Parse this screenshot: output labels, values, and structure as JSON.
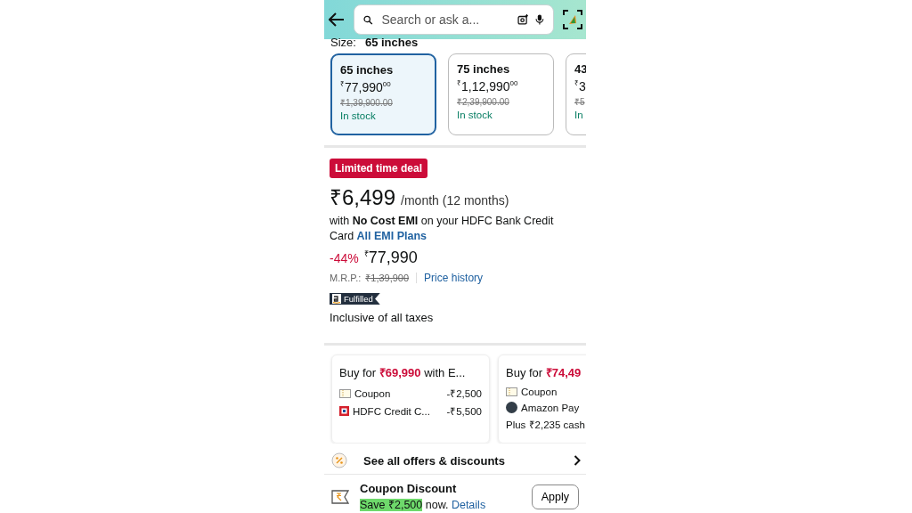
{
  "header": {
    "search": {
      "placeholder": "Search or ask a..."
    }
  },
  "size": {
    "label": "Size:",
    "value": "65 inches"
  },
  "size_options": [
    {
      "name": "65 inches",
      "price": "$^{₹}$77,990$^{00}$",
      "mrp": "₹1,39,900.00",
      "stock": "In stock",
      "selected": true
    },
    {
      "name": "75 inches",
      "price": "$^{₹}$1,12,990$^{00}$",
      "mrp": "₹2,39,900.00",
      "stock": "In stock",
      "selected": false
    },
    {
      "name": "43",
      "price": "$^{₹}$3",
      "mrp": "₹5",
      "stock": "In",
      "selected": false
    }
  ],
  "deal": {
    "badge": "Limited time deal",
    "emi_price": "₹6,499",
    "emi_period": "/month (12 months)",
    "emi_text": "with **No Cost EMI** on your HDFC Bank Credit Card",
    "emi_link": "All EMI Plans",
    "discount": "-44%",
    "price": "$^{₹}$77,990",
    "mrp_label": "M.R.P.:",
    "mrp": "₹1,39,900",
    "price_history": "Price history",
    "fulfilled": "Fulfilled",
    "taxes": "Inclusive of all taxes"
  },
  "offers": [
    {
      "title_pre": "Buy for ",
      "title_price": "₹69,990",
      "title_post": " with E...",
      "lines": [
        {
          "kind": "coupon",
          "label": "Coupon",
          "amount": "-₹2,500"
        },
        {
          "kind": "card",
          "label": "HDFC Credit C...",
          "amount": "-₹5,500"
        }
      ]
    },
    {
      "title_pre": "Buy for ",
      "title_price": "₹74,49",
      "lines": [
        {
          "kind": "coupon",
          "label": "Coupon"
        },
        {
          "kind": "wallet",
          "label": "Amazon Pay"
        },
        {
          "kind": "text",
          "label": "Plus ₹2,235 cash"
        }
      ]
    }
  ],
  "see_all": "See all offers & discounts",
  "coupon": {
    "title": "Coupon Discount",
    "highlight": "Save ₹2,500",
    "rest": " now.",
    "link": "Details",
    "button": "Apply"
  }
}
